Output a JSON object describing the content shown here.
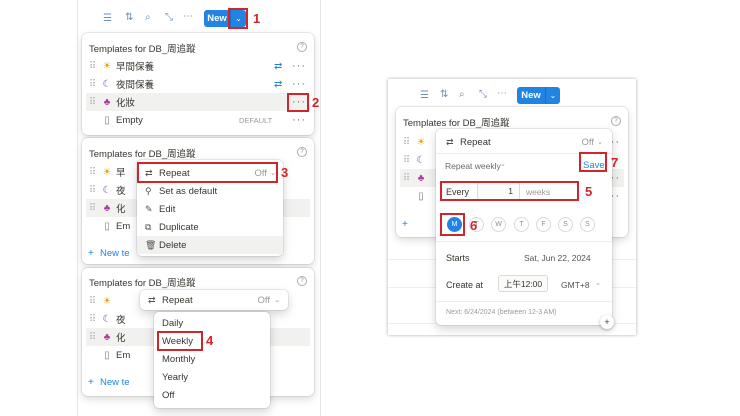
{
  "colors": {
    "accent": "#2383e2",
    "annotation_red": "#d0262b",
    "muted": "#9b9a97"
  },
  "toolbar": {
    "new_label": "New",
    "caret": "⌄"
  },
  "panels": {
    "header_title": "Templates for DB_周追蹤",
    "help_icon": "?",
    "items": {
      "morning": "早間保養",
      "night": "夜間保養",
      "makeup": "化妝",
      "empty": "Empty",
      "default_tag": "DEFAULT"
    },
    "new_template": "New te",
    "partial": {
      "morning": "早",
      "night": "夜",
      "makeup": "化",
      "empty": "Em"
    }
  },
  "context_menu": {
    "repeat": "Repeat",
    "repeat_state": "Off",
    "set_default": "Set as default",
    "edit": "Edit",
    "duplicate": "Duplicate",
    "delete": "Delete"
  },
  "frequency_menu": {
    "repeat": "Repeat",
    "repeat_state": "Off",
    "options": [
      "Daily",
      "Weekly",
      "Monthly",
      "Yearly",
      "Off"
    ],
    "bottom_new": "New te",
    "partial": {
      "morning": "早",
      "night": "夜",
      "makeup": "化",
      "empty": "Em"
    }
  },
  "repeat_settings": {
    "repeat_label": "Repeat",
    "repeat_state": "Off",
    "frequency": "Repeat weekly",
    "save": "Save",
    "every_label": "Every",
    "every_value": "1",
    "unit": "weeks",
    "days": [
      "M",
      "T",
      "W",
      "T",
      "F",
      "S",
      "S"
    ],
    "starts_label": "Starts",
    "starts_value": "Sat, Jun 22, 2024",
    "create_label": "Create at",
    "create_time": "上午12:00",
    "timezone": "GMT+8",
    "next": "Next: 6/24/2024 (between 12-3 AM)"
  },
  "annotations": [
    "1",
    "2",
    "3",
    "4",
    "5",
    "6",
    "7"
  ]
}
